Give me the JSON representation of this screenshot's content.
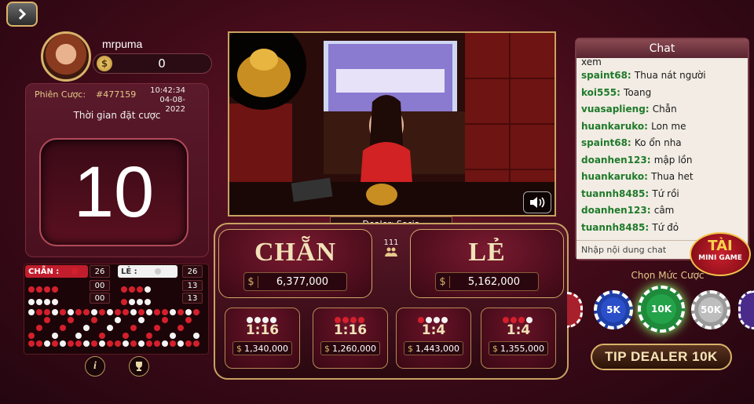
{
  "player": {
    "username": "mrpuma",
    "balance": "0",
    "currency_symbol": "$"
  },
  "session": {
    "label": "Phiên Cược:",
    "id": "#477159",
    "time": "10:42:34",
    "date": "04-08-2022",
    "bet_time_label": "Thời gian đặt cược",
    "countdown": "10"
  },
  "stats": {
    "chan_label": "CHẴN :",
    "chan_count": "26",
    "le_label": "LẺ :",
    "le_count": "26",
    "row2_a": "00",
    "row2_b": "13",
    "row3_a": "00",
    "row3_b": "13"
  },
  "dealer": {
    "label": "Dealer: Socia"
  },
  "players_count": "111",
  "bets": {
    "chan": {
      "title": "CHẴN",
      "amount": "6,377,000"
    },
    "le": {
      "title": "LẺ",
      "amount": "5,162,000"
    },
    "sub": [
      {
        "ratio": "1:16",
        "amount": "1,340,000",
        "dots": [
          "w",
          "w",
          "w",
          "w"
        ]
      },
      {
        "ratio": "1:16",
        "amount": "1,260,000",
        "dots": [
          "r",
          "r",
          "r",
          "r"
        ]
      },
      {
        "ratio": "1:4",
        "amount": "1,443,000",
        "dots": [
          "r",
          "w",
          "w",
          "w"
        ]
      },
      {
        "ratio": "1:4",
        "amount": "1,355,000",
        "dots": [
          "r",
          "r",
          "r",
          "w"
        ]
      }
    ]
  },
  "chat": {
    "title": "Chat",
    "partial_top": "xem",
    "messages": [
      {
        "user": "spaint68:",
        "text": "Thua nát người"
      },
      {
        "user": "koi555:",
        "text": "Toang"
      },
      {
        "user": "vuasaplieng:",
        "text": "Chẫn"
      },
      {
        "user": "huankaruko:",
        "text": "Lon me"
      },
      {
        "user": "spaint68:",
        "text": "Ko ổn nha"
      },
      {
        "user": "doanhen123:",
        "text": "mập lồn"
      },
      {
        "user": "huankaruko:",
        "text": "Thua het"
      },
      {
        "user": "tuannh8485:",
        "text": "Tứ rồi"
      },
      {
        "user": "doanhen123:",
        "text": "câm"
      },
      {
        "user": "tuannh8485:",
        "text": "Tứ đỏ"
      }
    ],
    "input_placeholder": "Nhập nội dung chat"
  },
  "mini_game": {
    "title": "TÀI",
    "subtitle": "MINI GAME"
  },
  "chips": {
    "label": "Chọn Mức Cược",
    "values": [
      "5K",
      "10K",
      "50K"
    ],
    "selected": "10K"
  },
  "tip_button": "TIP DEALER 10K",
  "colors": {
    "accent_gold": "#d9b36a",
    "red": "#d4202c",
    "bg": "#4a0e1c"
  }
}
